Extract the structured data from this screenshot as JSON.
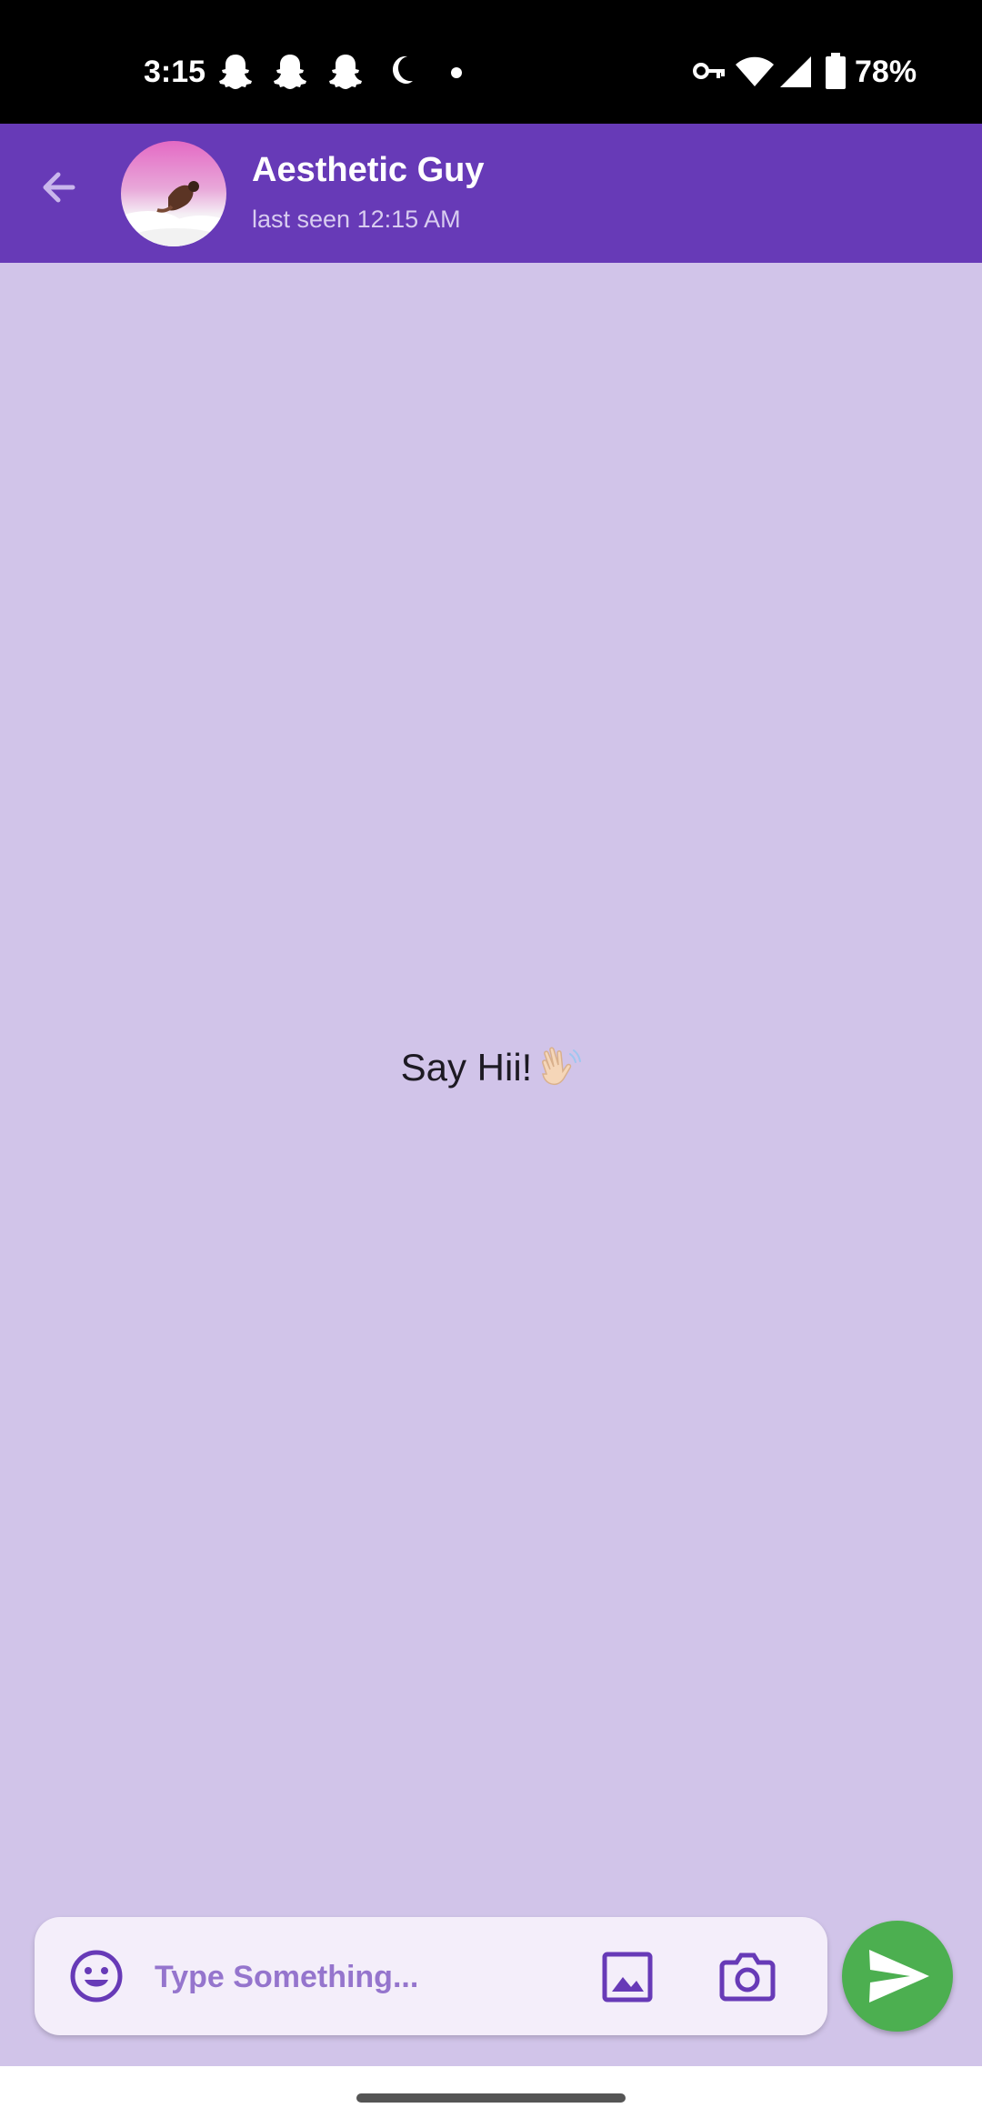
{
  "status_bar": {
    "time": "3:15",
    "battery": "78%",
    "icons": [
      "snapchat-icon",
      "snapchat-icon",
      "snapchat-icon",
      "moon-icon",
      "dot-icon",
      "vpn-key-icon",
      "wifi-icon",
      "signal-icon",
      "battery-icon"
    ]
  },
  "header": {
    "contact_name": "Aesthetic Guy",
    "last_seen": "last seen  12:15 AM"
  },
  "chat": {
    "empty_message": "Say Hii!"
  },
  "input": {
    "placeholder": "Type Something..."
  },
  "colors": {
    "app_bar": "#673AB7",
    "background": "#D1C4E9",
    "send_button": "#4CAF50",
    "input_bg": "#F4EEFA"
  }
}
